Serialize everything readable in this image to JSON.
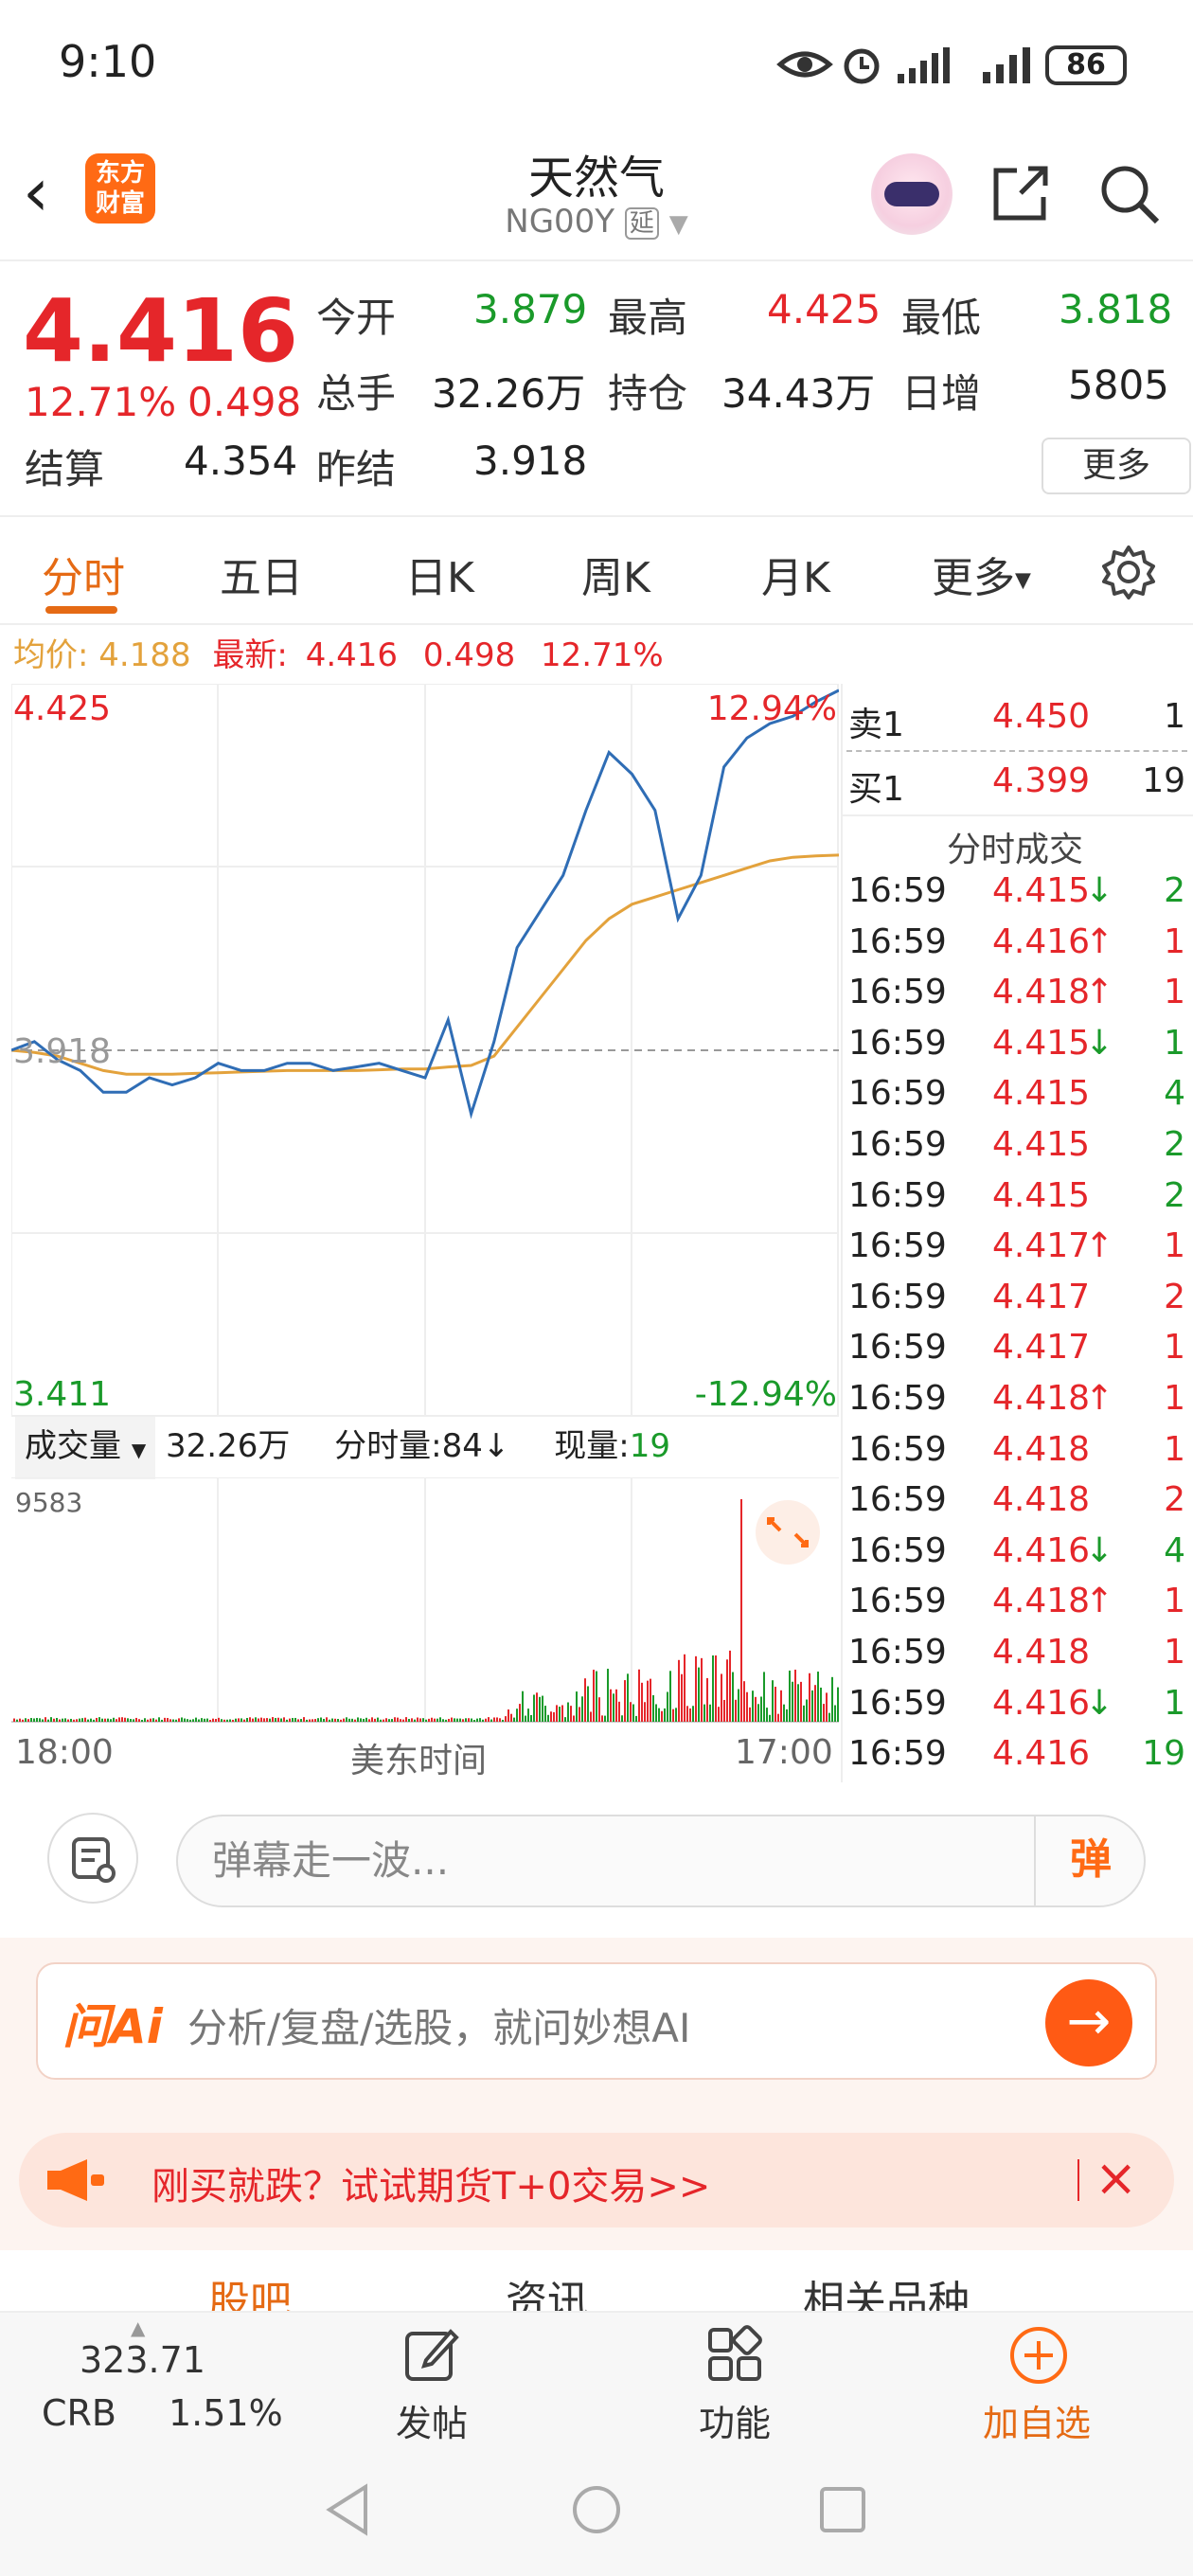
{
  "status_bar": {
    "time": "9:10",
    "battery": "86"
  },
  "header": {
    "logo_line1": "东方",
    "logo_line2": "财富",
    "title": "天然气",
    "code": "NG00Y",
    "delay_badge": "延"
  },
  "quote": {
    "price": "4.416",
    "change_pct": "12.71%",
    "change": "0.498",
    "settle_label": "结算",
    "settle": "4.354",
    "open_label": "今开",
    "open": "3.879",
    "high_label": "最高",
    "high": "4.425",
    "low_label": "最低",
    "low": "3.818",
    "volume_label": "总手",
    "volume": "32.26万",
    "oi_label": "持仓",
    "oi": "34.43万",
    "daily_inc_label": "日增",
    "daily_inc": "5805",
    "prev_settle_label": "昨结",
    "prev_settle": "3.918",
    "more_label": "更多"
  },
  "tabs": [
    "分时",
    "五日",
    "日K",
    "周K",
    "月K",
    "更多"
  ],
  "avg_row": {
    "avg_label": "均价:",
    "avg": "4.188",
    "latest_label": "最新:",
    "latest": "4.416",
    "chg": "0.498",
    "pct": "12.71%"
  },
  "chart_data": {
    "type": "line",
    "y_top": "4.425",
    "y_mid": "3.918",
    "y_bottom": "3.411",
    "pct_top": "12.94%",
    "pct_bottom": "-12.94%",
    "ylim": [
      3.411,
      4.425
    ],
    "price_series": [
      3.918,
      3.93,
      3.905,
      3.89,
      3.86,
      3.86,
      3.88,
      3.87,
      3.88,
      3.9,
      3.89,
      3.89,
      3.9,
      3.9,
      3.89,
      3.895,
      3.9,
      3.89,
      3.88,
      3.96,
      3.83,
      3.93,
      4.06,
      4.11,
      4.16,
      4.25,
      4.33,
      4.3,
      4.25,
      4.1,
      4.16,
      4.31,
      4.35,
      4.37,
      4.38,
      4.4,
      4.416
    ],
    "avg_series": [
      3.918,
      3.915,
      3.91,
      3.9,
      3.89,
      3.885,
      3.885,
      3.885,
      3.886,
      3.887,
      3.888,
      3.889,
      3.89,
      3.89,
      3.89,
      3.89,
      3.891,
      3.892,
      3.892,
      3.895,
      3.897,
      3.91,
      3.95,
      3.99,
      4.03,
      4.07,
      4.1,
      4.12,
      4.13,
      4.14,
      4.15,
      4.16,
      4.17,
      4.18,
      4.185,
      4.187,
      4.188
    ]
  },
  "volume_row": {
    "label": "成交量",
    "total": "32.26万",
    "interval_label": "分时量:",
    "interval": "84",
    "current_label": "现量:",
    "current": "19"
  },
  "volume_chart": {
    "max_label": "9583",
    "time_start": "18:00",
    "time_mid": "美东时间",
    "time_end": "17:00"
  },
  "order_book": {
    "ask_label": "卖1",
    "ask_price": "4.450",
    "ask_qty": "1",
    "bid_label": "买1",
    "bid_price": "4.399",
    "bid_qty": "19",
    "ticks_title": "分时成交",
    "ticks": [
      {
        "t": "16:59",
        "p": "4.415",
        "d": "↓",
        "q": "2",
        "dir": "down"
      },
      {
        "t": "16:59",
        "p": "4.416",
        "d": "↑",
        "q": "1",
        "dir": "up"
      },
      {
        "t": "16:59",
        "p": "4.418",
        "d": "↑",
        "q": "1",
        "dir": "up"
      },
      {
        "t": "16:59",
        "p": "4.415",
        "d": "↓",
        "q": "1",
        "dir": "down"
      },
      {
        "t": "16:59",
        "p": "4.415",
        "d": "",
        "q": "4",
        "dir": "flat"
      },
      {
        "t": "16:59",
        "p": "4.415",
        "d": "",
        "q": "2",
        "dir": "flat"
      },
      {
        "t": "16:59",
        "p": "4.415",
        "d": "",
        "q": "2",
        "dir": "flat"
      },
      {
        "t": "16:59",
        "p": "4.417",
        "d": "↑",
        "q": "1",
        "dir": "up"
      },
      {
        "t": "16:59",
        "p": "4.417",
        "d": "",
        "q": "2",
        "dir": "flatred"
      },
      {
        "t": "16:59",
        "p": "4.417",
        "d": "",
        "q": "1",
        "dir": "flatred"
      },
      {
        "t": "16:59",
        "p": "4.418",
        "d": "↑",
        "q": "1",
        "dir": "up"
      },
      {
        "t": "16:59",
        "p": "4.418",
        "d": "",
        "q": "1",
        "dir": "flatred"
      },
      {
        "t": "16:59",
        "p": "4.418",
        "d": "",
        "q": "2",
        "dir": "flatred"
      },
      {
        "t": "16:59",
        "p": "4.416",
        "d": "↓",
        "q": "4",
        "dir": "down"
      },
      {
        "t": "16:59",
        "p": "4.418",
        "d": "↑",
        "q": "1",
        "dir": "up"
      },
      {
        "t": "16:59",
        "p": "4.418",
        "d": "",
        "q": "1",
        "dir": "flatred"
      },
      {
        "t": "16:59",
        "p": "4.416",
        "d": "↓",
        "q": "1",
        "dir": "down"
      },
      {
        "t": "16:59",
        "p": "4.416",
        "d": "",
        "q": "19",
        "dir": "flat"
      }
    ]
  },
  "danmaku": {
    "placeholder": "弹幕走一波...",
    "button": "弹"
  },
  "ai": {
    "logo": "问Ai",
    "placeholder": "分析/复盘/选股，就问妙想AI"
  },
  "promo": {
    "text": "刚买就跌？试试期货T+0交易>>"
  },
  "subtabs": [
    "股吧",
    "资讯",
    "相关品种"
  ],
  "bottom_bar": {
    "index_value": "323.71",
    "index_name": "CRB",
    "index_pct": "1.51%",
    "post_label": "发帖",
    "func_label": "功能",
    "add_label": "加自选"
  },
  "colors": {
    "up": "#e5262a",
    "down": "#1a9a2a",
    "accent": "#ff6a14",
    "price_line": "#2f6db5",
    "avg_line": "#e3a23c"
  }
}
